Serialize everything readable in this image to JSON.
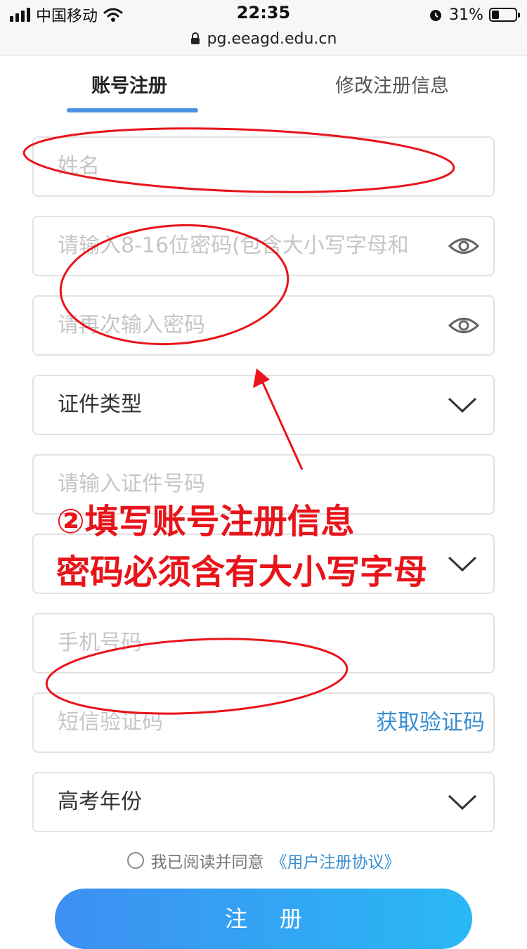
{
  "status_bar": {
    "carrier": "中国移动",
    "time": "22:35",
    "battery_percent": "31%",
    "battery_level": 0.31,
    "url": "pg.eeagd.edu.cn"
  },
  "tabs": [
    {
      "label": "账号注册",
      "active": true
    },
    {
      "label": "修改注册信息",
      "active": false
    }
  ],
  "form": {
    "name_placeholder": "姓名",
    "password_placeholder": "请输入8-16位密码(包含大小写字母和",
    "password_confirm_placeholder": "请再次输入密码",
    "id_type_value": "证件类型",
    "id_number_placeholder": "请输入证件号码",
    "phone_placeholder": "手机号码",
    "sms_code_placeholder": "短信验证码",
    "get_code_label": "获取验证码",
    "exam_year_value": "高考年份"
  },
  "agreement": {
    "text": "我已阅读并同意",
    "link": "《用户注册协议》"
  },
  "submit_label": "注册",
  "annotation": {
    "line1": "②填写账号注册信息",
    "line2": "密码必须含有大小写字母"
  },
  "colors": {
    "accent_blue": "#4a90e2",
    "link_blue": "#3a8fd0",
    "annotation_red": "#e8141a",
    "button_gradient_start": "#3d8ff2",
    "button_gradient_end": "#2ab8f5"
  }
}
